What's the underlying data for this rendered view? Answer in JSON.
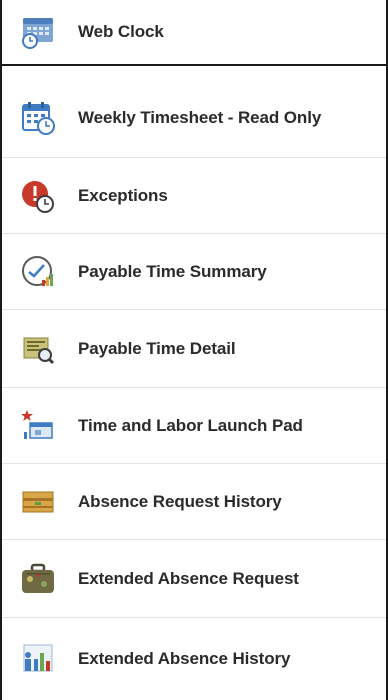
{
  "menu": {
    "items": [
      {
        "label": "Web Clock",
        "icon": "web-clock-icon",
        "selected": true
      },
      {
        "label": "Weekly Timesheet - Read Only",
        "icon": "calendar-clock-icon",
        "selected": false
      },
      {
        "label": "Exceptions",
        "icon": "exclamation-clock-icon",
        "selected": false
      },
      {
        "label": "Payable Time Summary",
        "icon": "gauge-chart-icon",
        "selected": false
      },
      {
        "label": "Payable Time Detail",
        "icon": "document-magnifier-icon",
        "selected": false
      },
      {
        "label": "Time and Labor Launch Pad",
        "icon": "launchpad-star-icon",
        "selected": false
      },
      {
        "label": "Absence Request History",
        "icon": "ledger-book-icon",
        "selected": false
      },
      {
        "label": "Extended Absence Request",
        "icon": "suitcase-icon",
        "selected": false
      },
      {
        "label": "Extended Absence History",
        "icon": "bar-chart-person-icon",
        "selected": false
      }
    ]
  },
  "colors": {
    "text": "#2b2b2b",
    "divider": "#e3e3e3",
    "selected_border": "#1a1a1a",
    "accent_blue": "#3f7cc4",
    "accent_red": "#c8382b"
  }
}
